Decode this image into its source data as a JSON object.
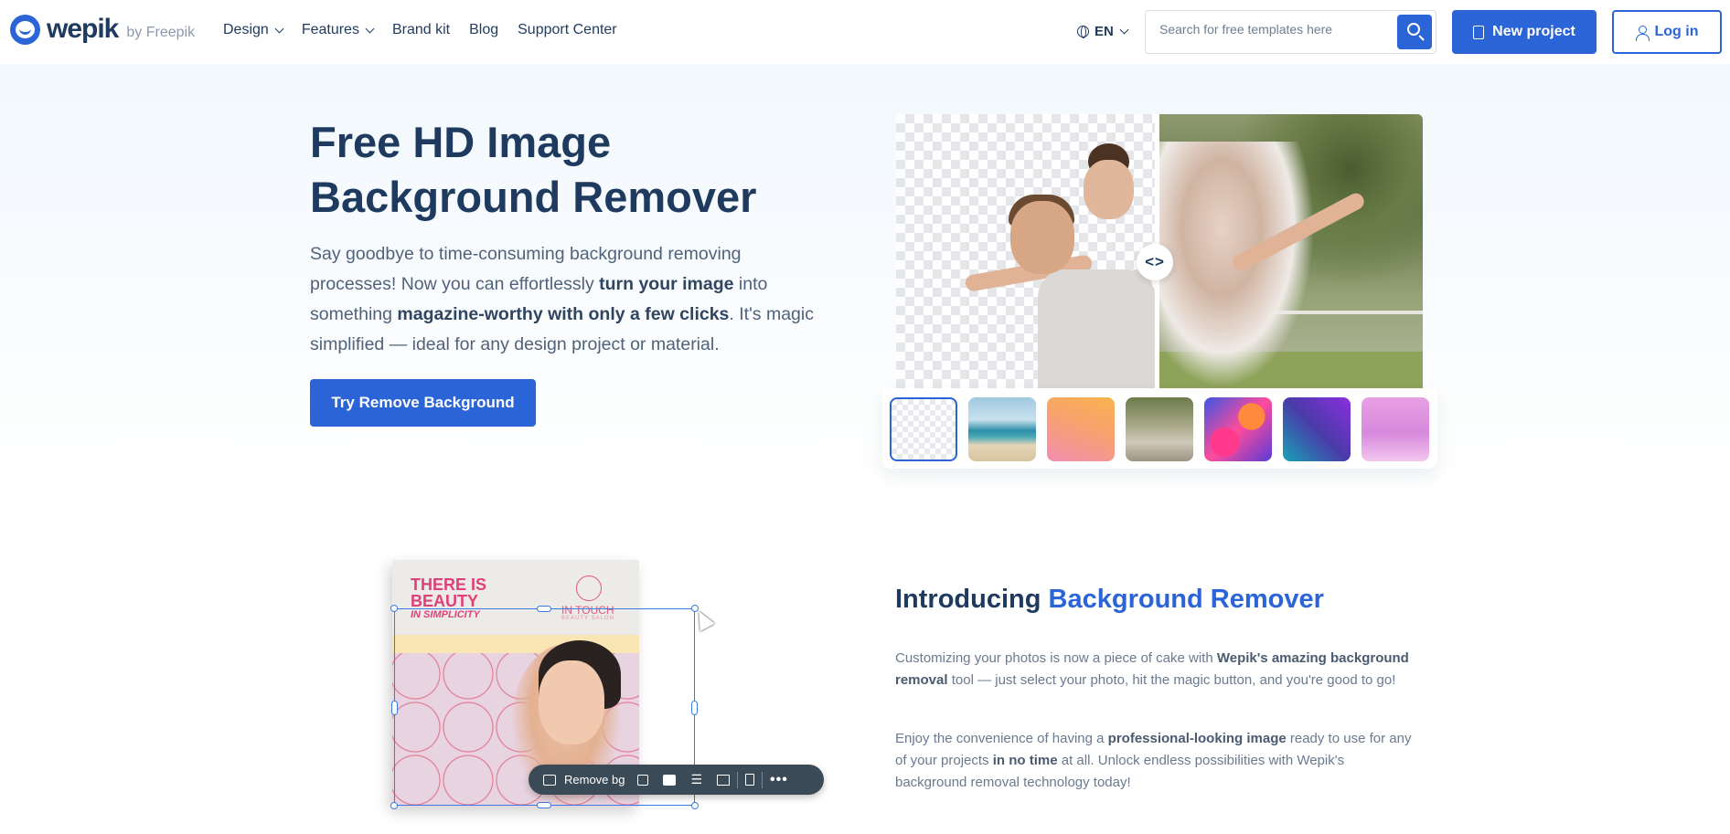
{
  "brand": {
    "name": "wepik",
    "by": "by Freepik",
    "accent": "#2b64d6",
    "dark": "#1f3a5f"
  },
  "nav": {
    "items": [
      {
        "label": "Design",
        "dropdown": true
      },
      {
        "label": "Features",
        "dropdown": true
      },
      {
        "label": "Brand kit",
        "dropdown": false
      },
      {
        "label": "Blog",
        "dropdown": false
      },
      {
        "label": "Support Center",
        "dropdown": false
      }
    ],
    "language": "EN",
    "search_placeholder": "Search for free templates here",
    "new_project": "New project",
    "login": "Log in"
  },
  "hero": {
    "title": "Free HD Image Background Remover",
    "text_parts": [
      "Say goodbye to time-consuming background removing processes! Now you can effortlessly ",
      "turn your image",
      " into something ",
      "magazine-worthy with only a few clicks",
      ". It's magic simplified — ideal for any design project or material."
    ],
    "cta": "Try Remove Background",
    "compare_handle": "<>",
    "backgrounds": [
      "transparent",
      "beach",
      "orange-pink gradient",
      "tree avenue",
      "pink waves",
      "purple-teal gradient",
      "lilac gradient"
    ],
    "selected_background": "transparent"
  },
  "mockup": {
    "headline": "THERE IS BEAUTY",
    "tagline": "IN SIMPLICITY",
    "logo_title": "IN TOUCH",
    "logo_sub": "BEAUTY SALON",
    "toolbar_label": "Remove bg"
  },
  "intro": {
    "title_plain": "Introducing ",
    "title_accent": "Background Remover",
    "p1_parts": [
      "Customizing your photos is now a piece of cake with ",
      "Wepik's amazing background removal",
      " tool — just select your photo, hit the magic button, and you're good to go!"
    ],
    "p2_parts": [
      "Enjoy the convenience of having a ",
      "professional-looking image",
      " ready to use for any of your projects ",
      "in no time",
      " at all. Unlock endless possibilities with Wepik's background removal technology today!"
    ]
  }
}
